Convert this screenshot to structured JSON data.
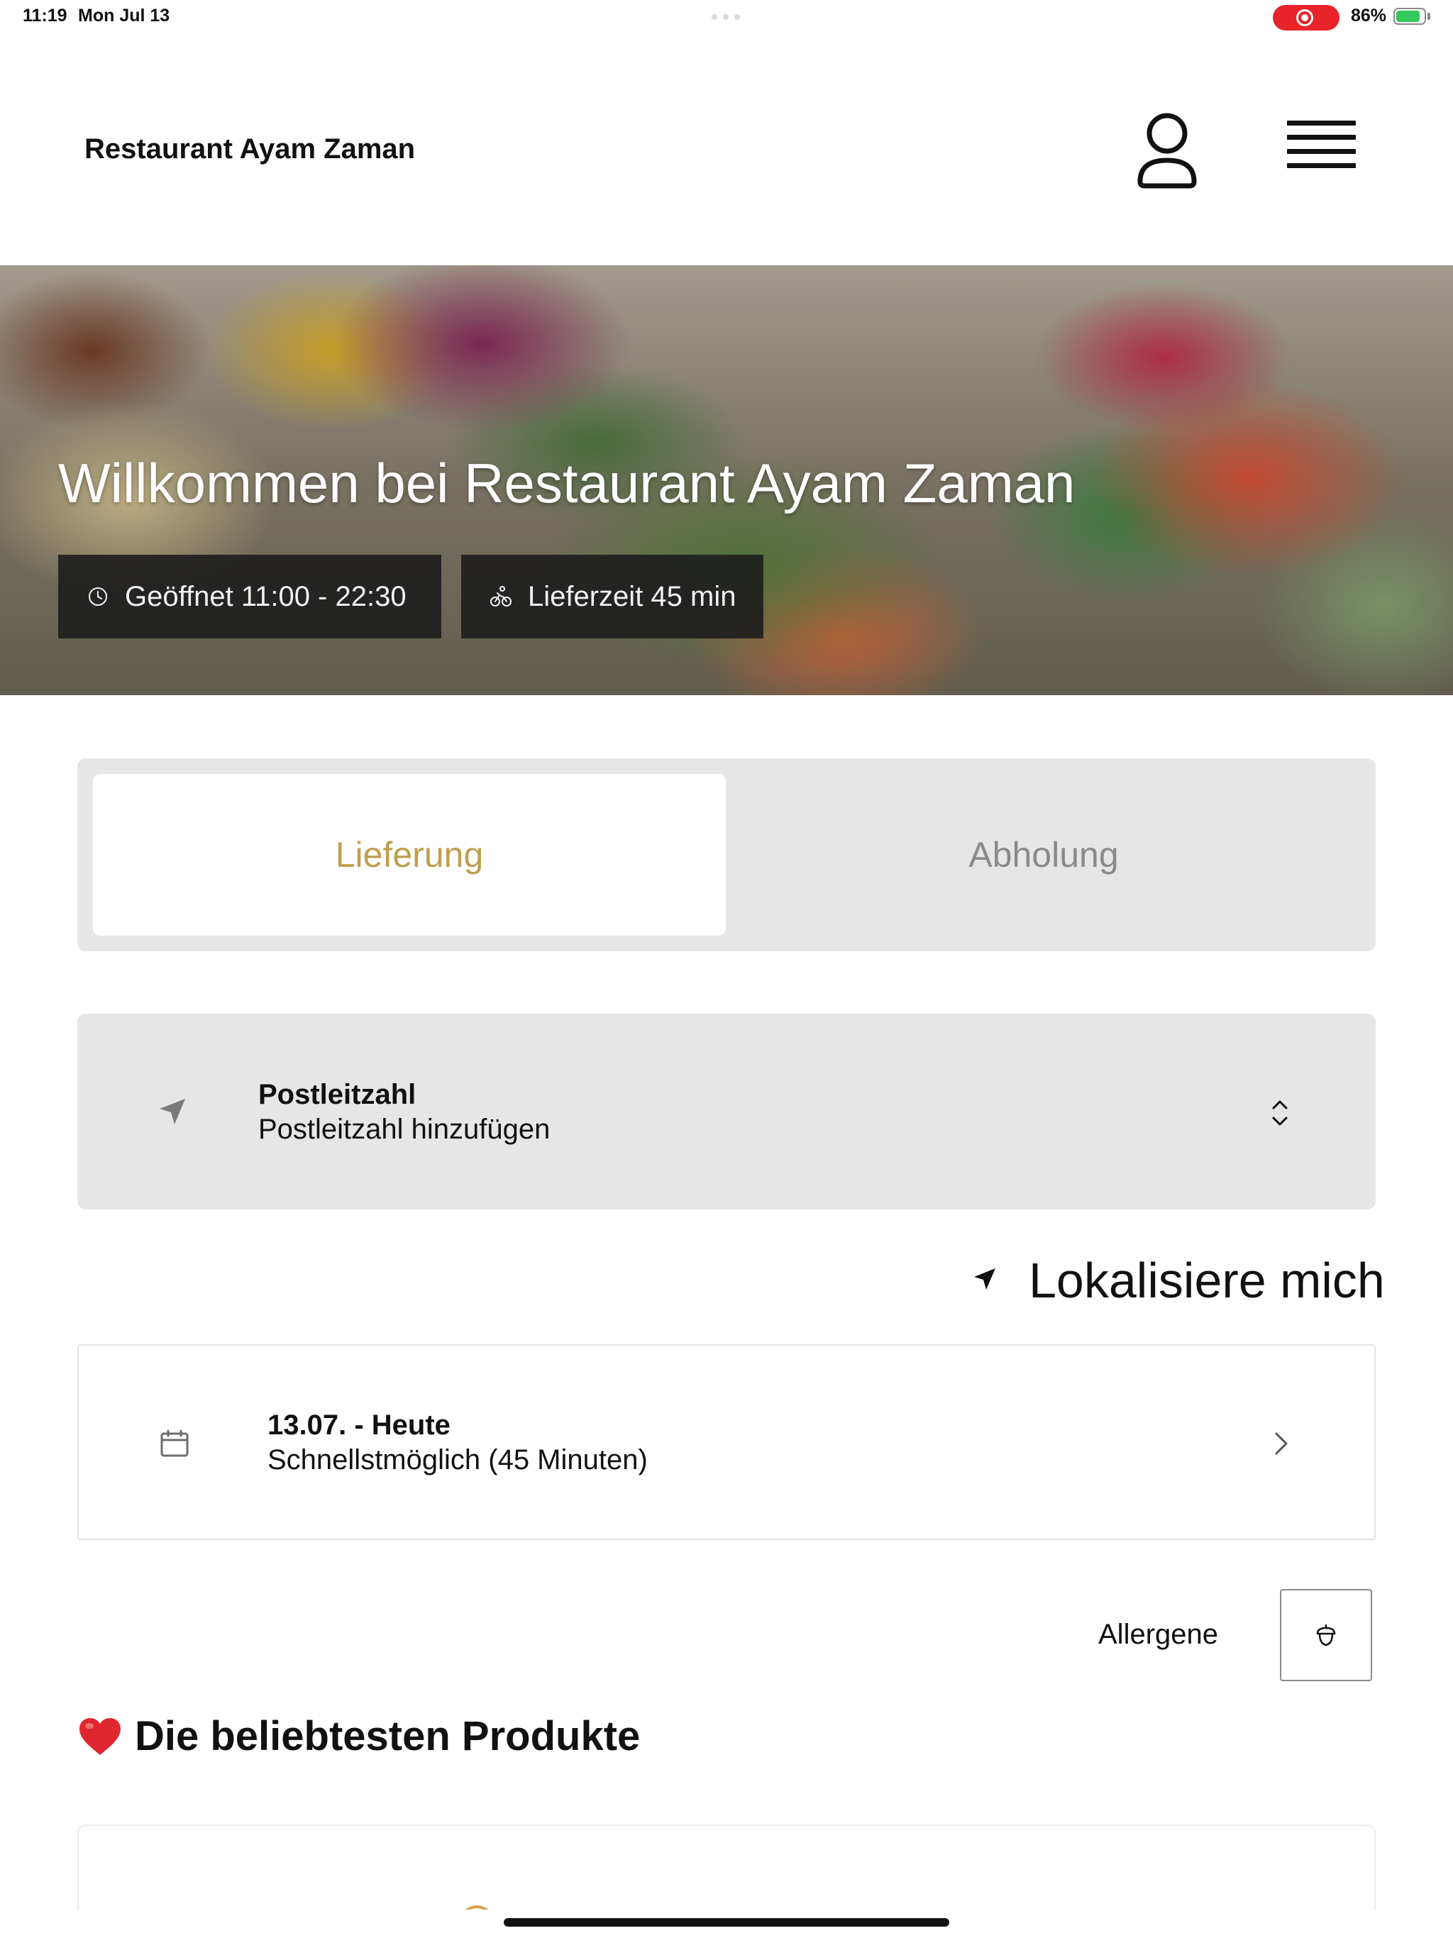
{
  "status_bar": {
    "time": "11:19",
    "date": "Mon Jul 13",
    "battery": "86%",
    "battery_level": 0.86,
    "record_color": "#e8232a"
  },
  "header": {
    "brand": "Restaurant Ayam Zaman",
    "account_icon": "person-icon",
    "menu_icon": "hamburger-menu-icon"
  },
  "hero": {
    "title": "Willkommen bei Restaurant Ayam Zaman",
    "opening_hours": "Geöffnet 11:00 - 22:30",
    "delivery_time": "Lieferzeit 45 min"
  },
  "order_mode": {
    "delivery": "Lieferung",
    "pickup": "Abholung",
    "selected": "delivery",
    "accent_color": "#bf9f4d"
  },
  "postal_code": {
    "label": "Postleitzahl",
    "value": "Postleitzahl hinzufügen"
  },
  "locate_me": "Lokalisiere mich",
  "schedule": {
    "label": "13.07. - Heute",
    "value": "Schnellstmöglich (45 Minuten)"
  },
  "allergens": {
    "label": "Allergene",
    "icon": "acorn-icon"
  },
  "popular_section": {
    "title": "Die beliebtesten Produkte",
    "icon": "heart-icon"
  }
}
